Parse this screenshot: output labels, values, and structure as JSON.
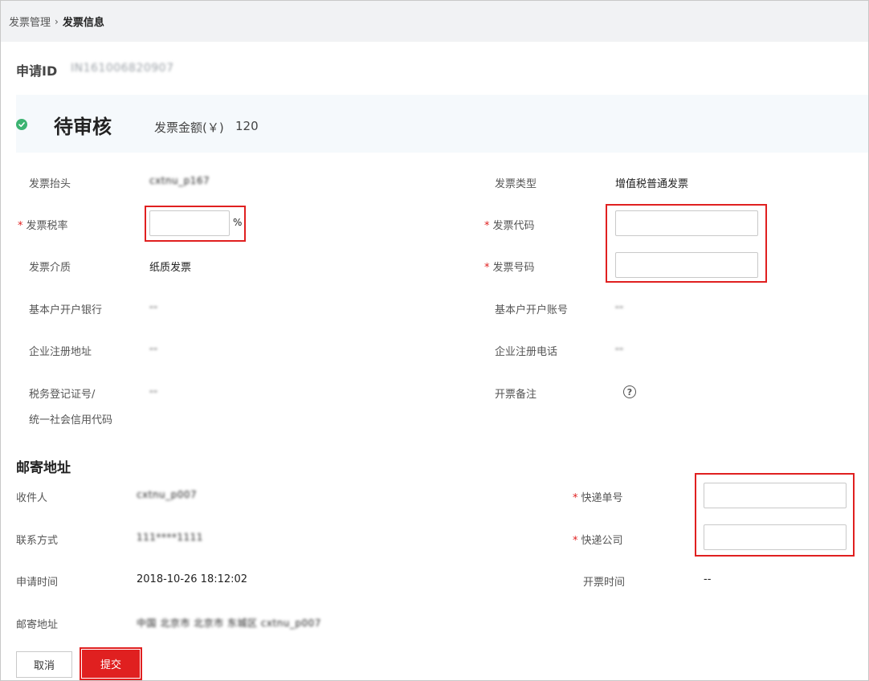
{
  "breadcrumb": {
    "parent": "发票管理",
    "separator": "›",
    "current": "发票信息"
  },
  "application": {
    "id_label": "申请ID",
    "id_value": "IN161006820907"
  },
  "status": {
    "title": "待审核",
    "amount_label": "发票金额(￥)",
    "amount_value": "120",
    "color": "#3cb371"
  },
  "invoice": {
    "title_label": "发票抬头",
    "title_value": "cxtnu_p167",
    "type_label": "发票类型",
    "type_value": "增值税普通发票",
    "tax_rate_label": "发票税率",
    "tax_rate_unit": "%",
    "tax_rate_value": "",
    "code_label": "发票代码",
    "code_value": "",
    "medium_label": "发票介质",
    "medium_value": "纸质发票",
    "number_label": "发票号码",
    "number_value": "",
    "bank_label": "基本户开户银行",
    "bank_value": "--",
    "account_label": "基本户开户账号",
    "account_value": "--",
    "reg_address_label": "企业注册地址",
    "reg_address_value": "--",
    "reg_phone_label": "企业注册电话",
    "reg_phone_value": "--",
    "tax_id_label_line1": "税务登记证号/",
    "tax_id_label_line2": "统一社会信用代码",
    "tax_id_value": "--",
    "remark_label": "开票备注",
    "remark_icon": "help-circle-icon",
    "required_mark": "*"
  },
  "mailing": {
    "section_title": "邮寄地址",
    "recipient_label": "收件人",
    "recipient_value": "cxtnu_p007",
    "contact_label": "联系方式",
    "contact_value": "111****1111",
    "apply_time_label": "申请时间",
    "apply_time_value": "2018-10-26 18:12:02",
    "invoice_time_label": "开票时间",
    "invoice_time_value": "--",
    "address_label": "邮寄地址",
    "address_value": "中国 北京市 北京市 东城区 cxtnu_p007",
    "tracking_label": "快递单号",
    "tracking_value": "",
    "courier_label": "快递公司",
    "courier_value": ""
  },
  "actions": {
    "cancel_label": "取消",
    "submit_label": "提交",
    "submit_color": "#e02020"
  },
  "colors": {
    "highlight": "#e02020",
    "breadcrumb_bg": "#f1f2f4",
    "status_bg": "#f5f9fc"
  }
}
